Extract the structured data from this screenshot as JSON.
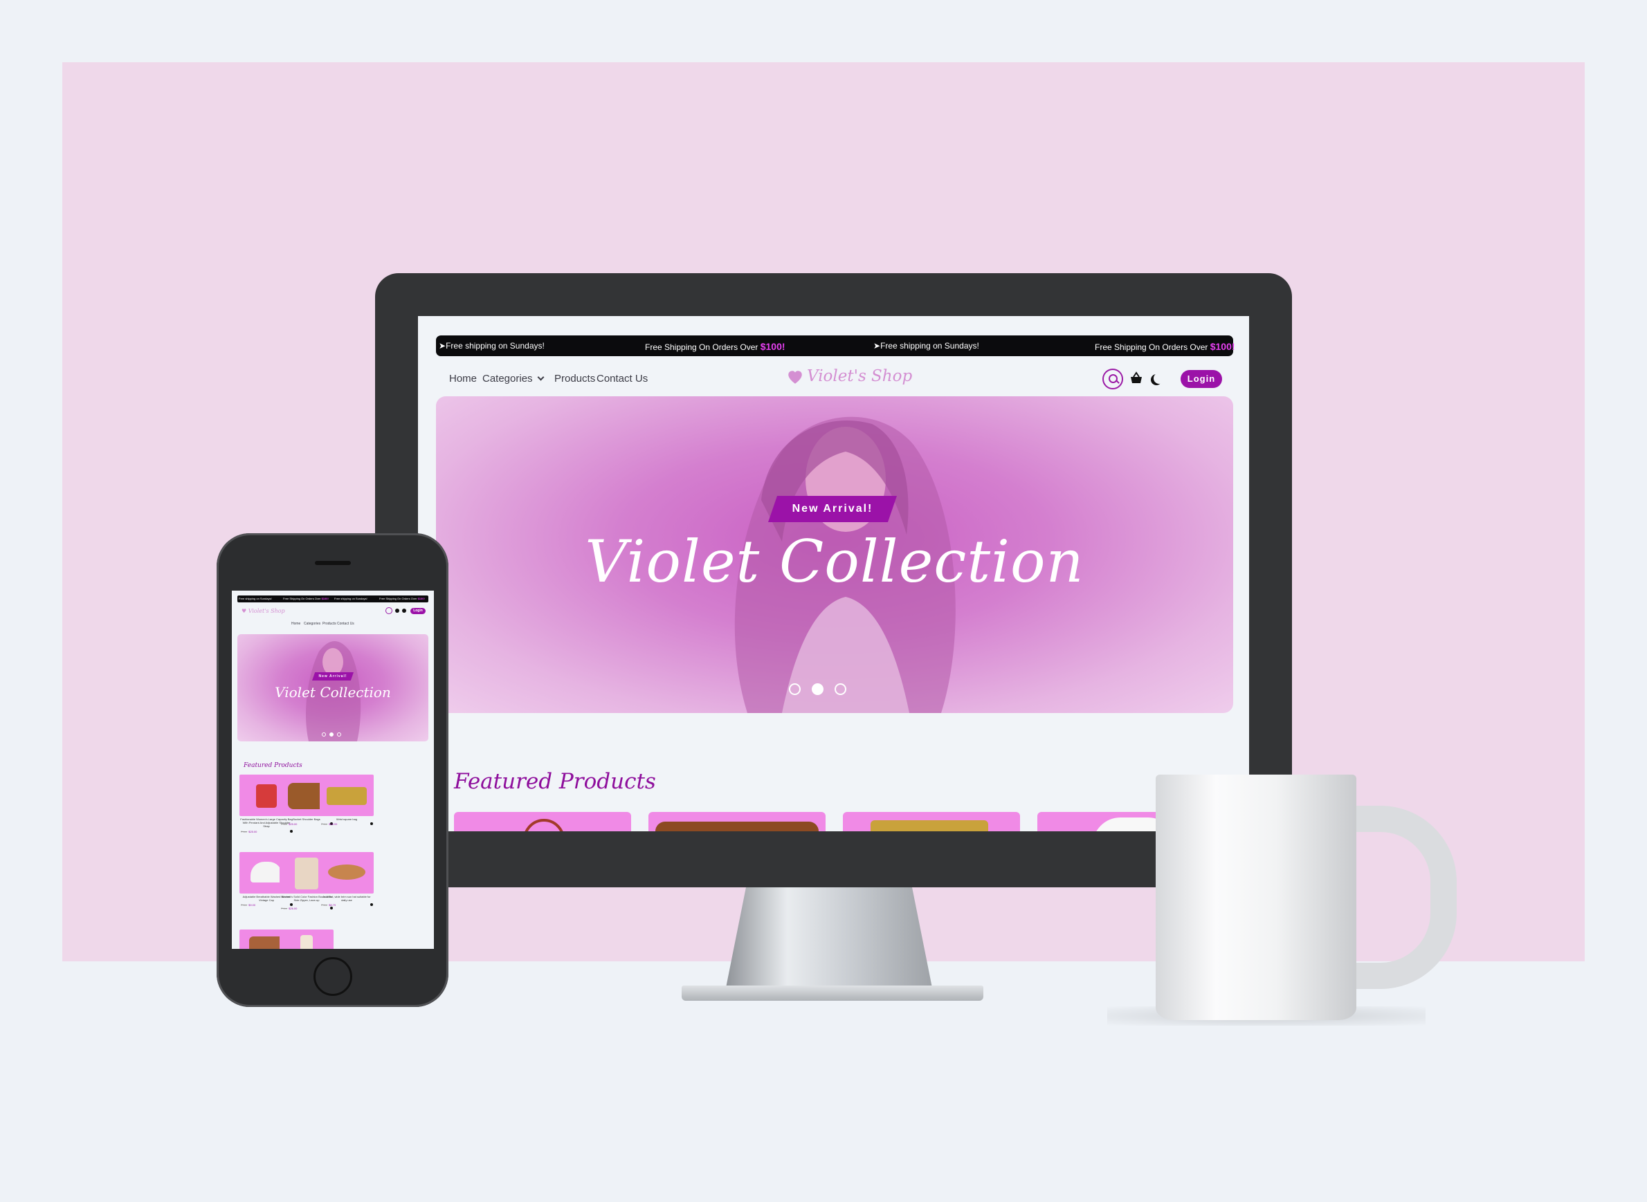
{
  "ticker": {
    "items": [
      {
        "text": "Free shipping on Sundays!",
        "highlight": ""
      },
      {
        "text": "Free Shipping On Orders Over ",
        "highlight": "$100!"
      },
      {
        "text": "Free shipping on Sundays!",
        "highlight": ""
      },
      {
        "text": "Free Shipping On Orders Over ",
        "highlight": "$100!"
      }
    ]
  },
  "nav": {
    "home": "Home",
    "categories": "Categories",
    "products": "Products",
    "contact": "Contact Us",
    "logo": "Violet's Shop",
    "login": "Login"
  },
  "hero": {
    "badge": "New Arrival!",
    "title": "Violet Collection",
    "slides": 3,
    "active_slide": 2
  },
  "featured": {
    "title": "Featured Products"
  },
  "mobile": {
    "products": [
      {
        "name": "Fashionable Women's Large Capacity Bag With Pendant And Adjustable Shoulder Strap",
        "old_price": "Price",
        "price": "$25.00",
        "color": "#d63b3b"
      },
      {
        "name": "Bucket Shoulder Bags",
        "old_price": "Price",
        "price": "$25.00",
        "color": "#9a5a2a"
      },
      {
        "name": "Wrist square bag",
        "old_price": "Price",
        "price": "$18.99",
        "color": "#c9a23b"
      },
      {
        "name": "Adjustable Breathable Washed Neutral Vintage Cap",
        "old_price": "Price",
        "price": "$9.00",
        "color": "#f4f4f4"
      },
      {
        "name": "Women's Solid Color Fashion Boots With Side Zipper, Lace-up",
        "old_price": "Price",
        "price": "$26.00",
        "color": "#e8d6c4"
      },
      {
        "name": "Jazz hat, wide brim sun hat suitable for daily use",
        "old_price": "Price",
        "price": "$8.79",
        "color": "#c7854e"
      },
      {
        "name": "",
        "old_price": "",
        "price": "",
        "color": "#a8623a"
      },
      {
        "name": "",
        "old_price": "",
        "price": "",
        "color": "#f1e6d6"
      }
    ]
  },
  "colors": {
    "accent": "#9b12a8",
    "backdrop": "#efd8ea",
    "card": "#f08ae6"
  }
}
